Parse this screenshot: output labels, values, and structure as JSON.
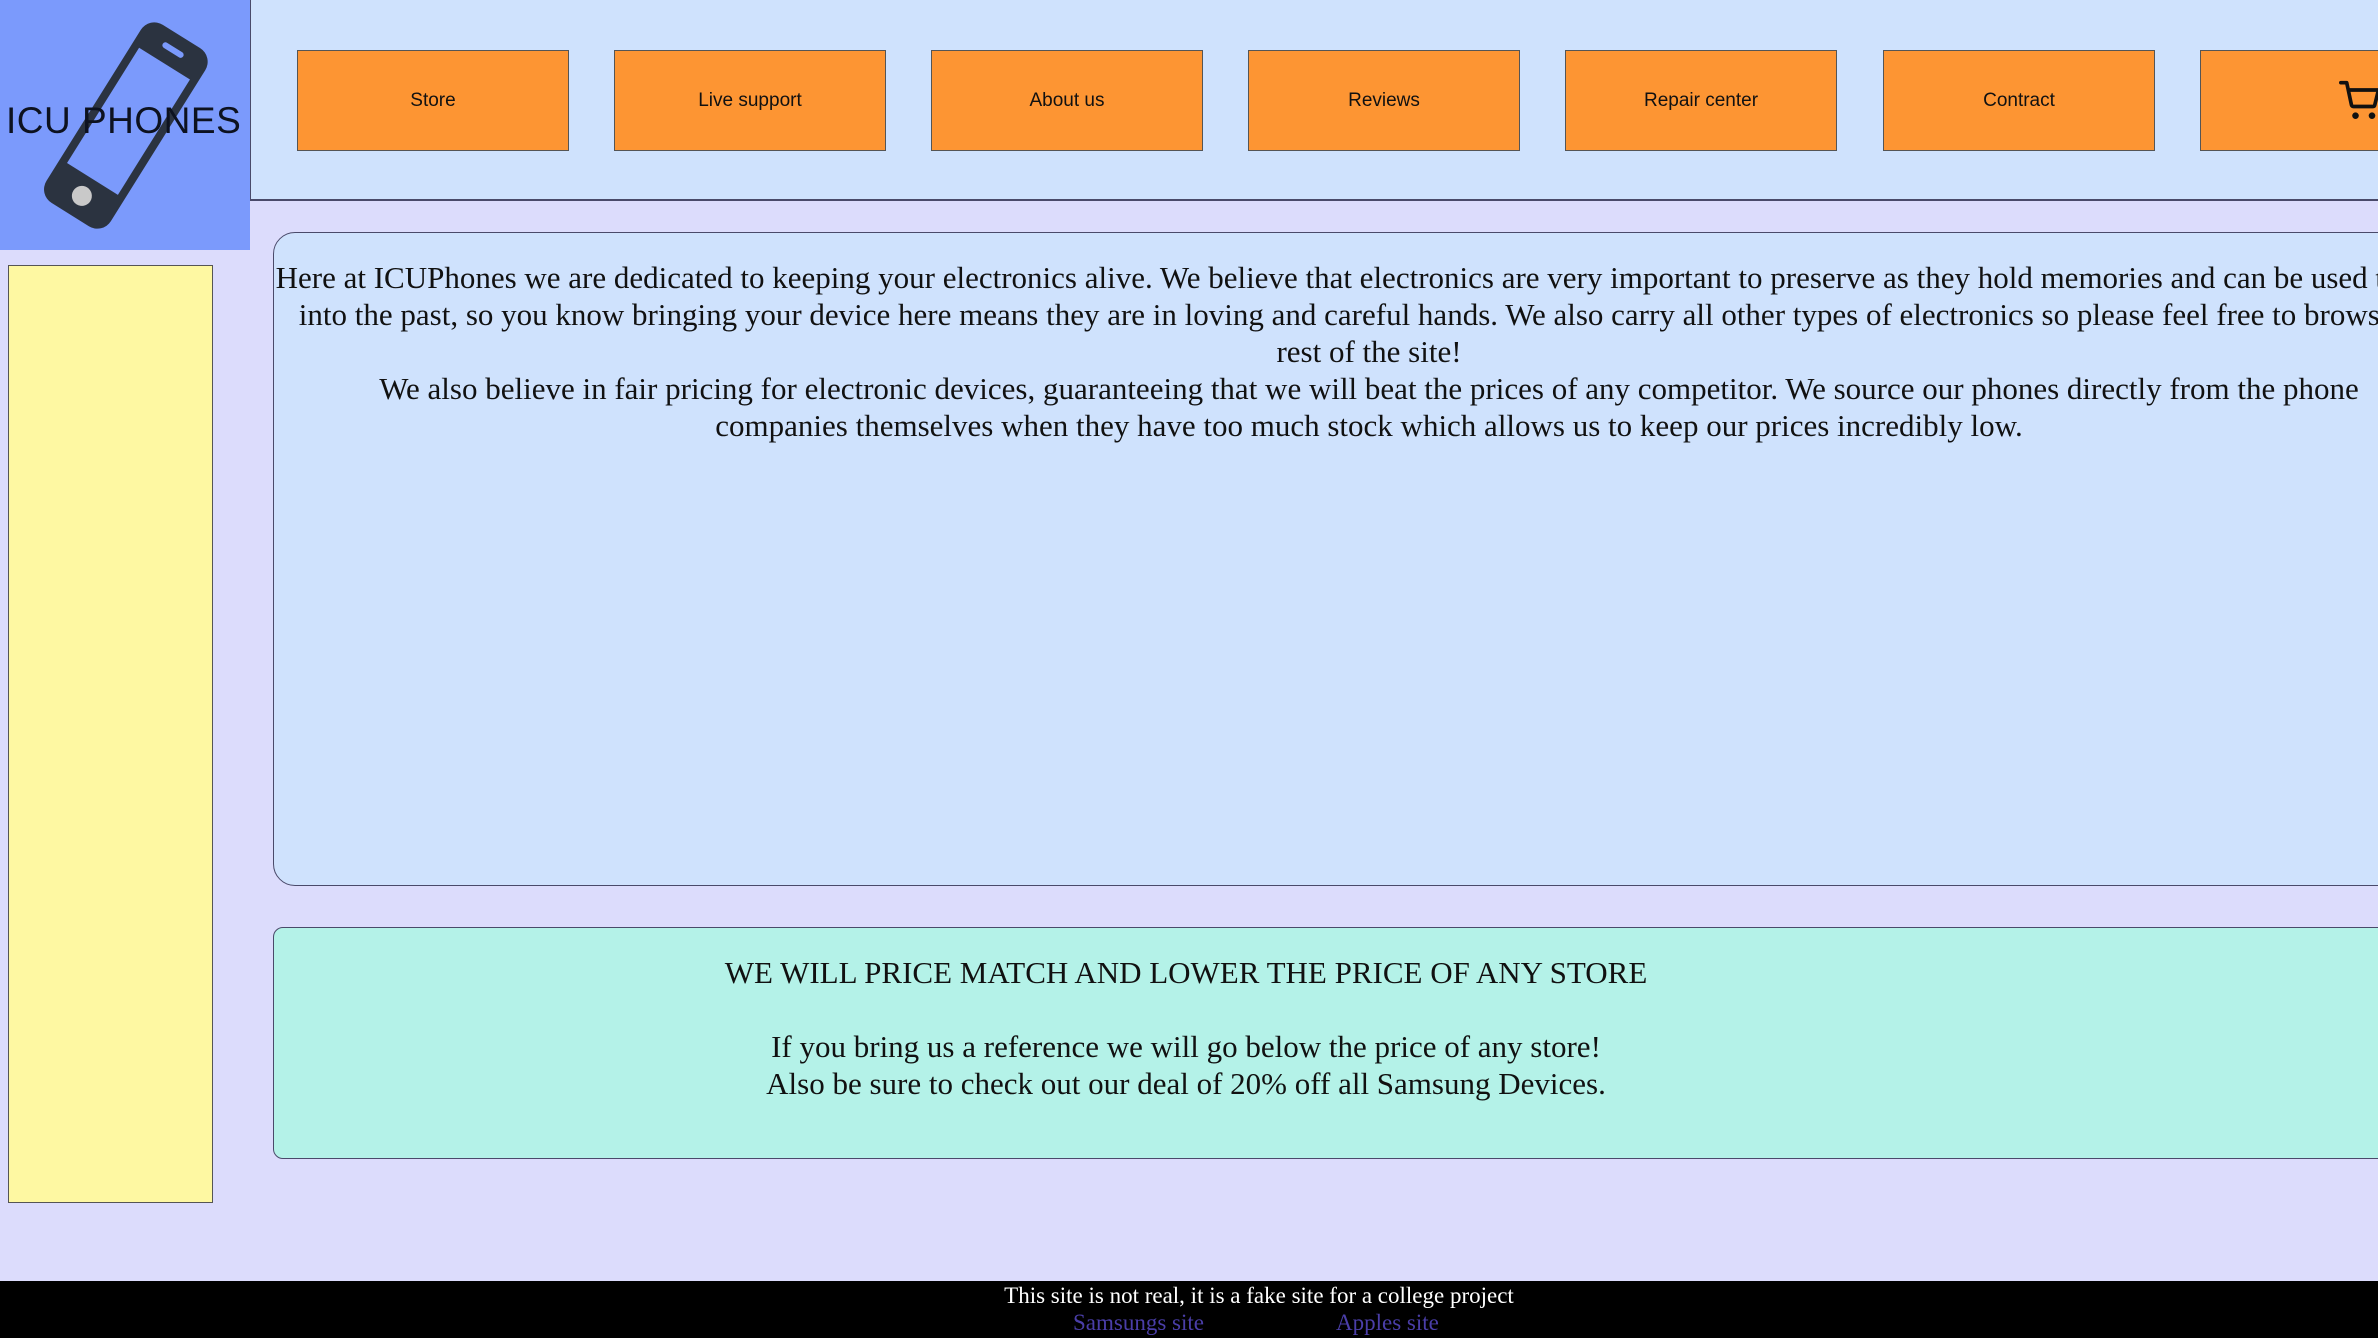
{
  "logo": {
    "text": "ICU PHONES",
    "icon": "smartphone-icon"
  },
  "nav": {
    "items": [
      {
        "label": "Store"
      },
      {
        "label": "Live support"
      },
      {
        "label": "About us"
      },
      {
        "label": "Reviews"
      },
      {
        "label": "Repair center"
      },
      {
        "label": "Contract"
      }
    ],
    "cart_icon": "shopping-cart-icon"
  },
  "about": {
    "paragraph_1": "Here at ICUPhones we are dedicated to keeping your electronics alive. We believe that electronics are very important to preserve as they hold memories and can be used to look into the past, so you know bringing your device here means they are in loving and careful hands. We also carry all other types of electronics so please feel free to browse the rest of the site!",
    "paragraph_2": "We also believe in fair pricing for electronic devices, guaranteeing that we will beat the prices of any competitor. We source our phones directly from the phone companies themselves when they have too much stock which allows us to keep our prices incredibly low."
  },
  "deal": {
    "heading": "WE WILL PRICE MATCH AND LOWER THE PRICE OF ANY STORE",
    "line_1": "If you bring us a reference we will go below the price of any store!",
    "line_2": "Also be sure to check out our deal of 20% off all Samsung Devices."
  },
  "footer": {
    "note": "This site is not real, it is a fake site for a college project",
    "link_samsung": "Samsungs site",
    "link_apple": "Apples site"
  },
  "colors": {
    "logo_bg": "#7b9afc",
    "header_bg": "#cfe2fd",
    "page_bg": "#dcdcfc",
    "nav_button": "#fd9533",
    "sidebar_bg": "#fef8a2",
    "deal_bg": "#b4f2e8",
    "footer_bg": "#000000",
    "footer_link": "#4a3ea8"
  }
}
